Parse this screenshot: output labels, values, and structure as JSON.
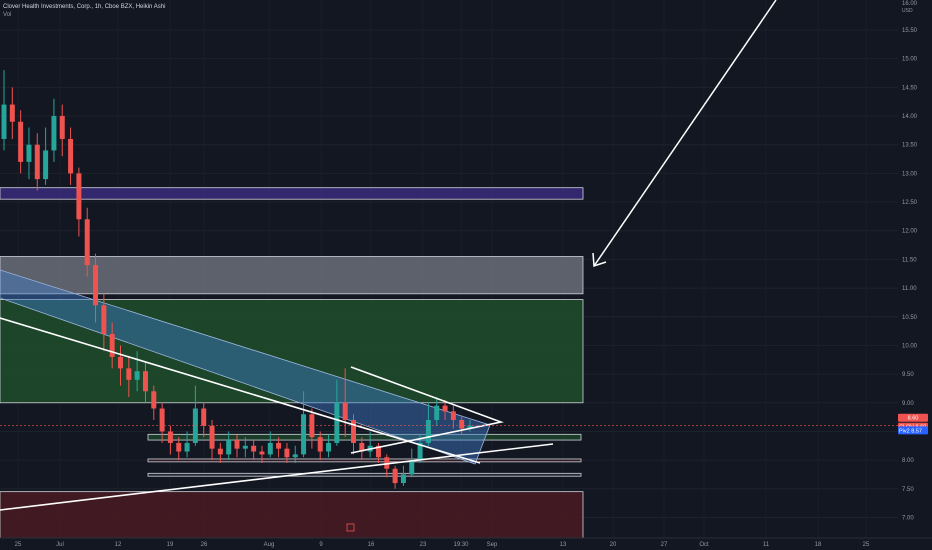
{
  "header": {
    "title": "Clover Health Investments, Corp., 1h, Cboe BZX, Heikin Ashi",
    "volume_label": "Vol"
  },
  "colors": {
    "background": "#131722",
    "up": "#26a69a",
    "down": "#ef5350",
    "purple_zone": "#3a2a7a",
    "grey_zone": "#6b6e78",
    "green_zone": "#1e4d2b",
    "red_zone": "#4a1a22",
    "blue_channel": "#3d7cc9"
  },
  "chart_data": {
    "type": "candlestick",
    "y_unit": "USD",
    "ylim": [
      6.75,
      16.0
    ],
    "y_ticks": [
      7.0,
      7.5,
      8.0,
      8.5,
      9.0,
      9.5,
      10.0,
      10.5,
      11.0,
      11.5,
      12.0,
      12.5,
      13.0,
      13.5,
      14.0,
      14.5,
      15.0,
      15.5
    ],
    "x_ticks": [
      "25",
      "Jul",
      "12",
      "19",
      "26",
      "Aug",
      "9",
      "16",
      "23",
      "19:30",
      "Sep",
      "13",
      "20",
      "27",
      "Oct",
      "11",
      "18",
      "25"
    ],
    "last_price_label": "CLOV",
    "last_price": "8.60",
    "last_price_top": "8.60",
    "pivot_label": "Piv2",
    "pivot_value": "8.57",
    "zones": [
      {
        "name": "purple",
        "low": 12.55,
        "high": 12.75
      },
      {
        "name": "grey",
        "low": 10.9,
        "high": 11.55
      },
      {
        "name": "green",
        "low": 9.0,
        "high": 10.8
      },
      {
        "name": "support-1",
        "low": 8.35,
        "high": 8.45
      },
      {
        "name": "support-2",
        "low": 7.97,
        "high": 8.02
      },
      {
        "name": "support-3",
        "low": 7.72,
        "high": 7.77
      },
      {
        "name": "red",
        "low": 6.5,
        "high": 7.45
      }
    ],
    "candles": [
      [
        13.6,
        14.2,
        14.8,
        13.4
      ],
      [
        14.2,
        13.9,
        14.5,
        13.6
      ],
      [
        13.9,
        13.2,
        14.1,
        13.0
      ],
      [
        13.2,
        13.5,
        13.8,
        12.9
      ],
      [
        13.5,
        12.9,
        13.7,
        12.7
      ],
      [
        12.9,
        13.4,
        13.8,
        12.8
      ],
      [
        13.4,
        14.0,
        14.3,
        13.2
      ],
      [
        14.0,
        13.6,
        14.2,
        13.3
      ],
      [
        13.6,
        13.0,
        13.8,
        12.8
      ],
      [
        13.0,
        12.2,
        13.1,
        11.9
      ],
      [
        12.2,
        11.4,
        12.4,
        11.2
      ],
      [
        11.4,
        10.7,
        11.6,
        10.4
      ],
      [
        10.7,
        10.2,
        10.9,
        9.9
      ],
      [
        10.2,
        9.8,
        10.4,
        9.6
      ],
      [
        9.8,
        9.6,
        10.0,
        9.3
      ],
      [
        9.6,
        9.4,
        9.8,
        9.1
      ],
      [
        9.4,
        9.55,
        9.9,
        9.2
      ],
      [
        9.55,
        9.2,
        9.7,
        9.0
      ],
      [
        9.2,
        8.9,
        9.3,
        8.7
      ],
      [
        8.9,
        8.5,
        9.0,
        8.3
      ],
      [
        8.5,
        8.3,
        8.6,
        8.1
      ],
      [
        8.3,
        8.15,
        8.4,
        8.0
      ],
      [
        8.15,
        8.3,
        8.5,
        8.05
      ],
      [
        8.3,
        8.9,
        9.3,
        8.25
      ],
      [
        8.9,
        8.6,
        9.0,
        8.4
      ],
      [
        8.6,
        8.2,
        8.7,
        8.0
      ],
      [
        8.2,
        8.1,
        8.3,
        7.95
      ],
      [
        8.1,
        8.35,
        8.5,
        8.0
      ],
      [
        8.35,
        8.2,
        8.45,
        8.05
      ],
      [
        8.2,
        8.25,
        8.4,
        8.05
      ],
      [
        8.25,
        8.15,
        8.35,
        8.0
      ],
      [
        8.15,
        8.1,
        8.25,
        7.95
      ],
      [
        8.1,
        8.3,
        8.5,
        8.05
      ],
      [
        8.3,
        8.2,
        8.4,
        8.05
      ],
      [
        8.2,
        8.05,
        8.3,
        7.95
      ],
      [
        8.05,
        8.1,
        8.25,
        7.95
      ],
      [
        8.1,
        8.8,
        9.2,
        8.05
      ],
      [
        8.8,
        8.4,
        8.9,
        8.2
      ],
      [
        8.4,
        8.15,
        8.5,
        8.0
      ],
      [
        8.15,
        8.3,
        8.45,
        8.05
      ],
      [
        8.3,
        9.0,
        9.4,
        8.25
      ],
      [
        9.0,
        8.7,
        9.6,
        8.4
      ],
      [
        8.7,
        8.3,
        8.8,
        8.1
      ],
      [
        8.3,
        8.15,
        8.4,
        8.0
      ],
      [
        8.15,
        8.25,
        8.5,
        8.05
      ],
      [
        8.25,
        8.05,
        8.3,
        7.95
      ],
      [
        8.05,
        7.85,
        8.1,
        7.7
      ],
      [
        7.85,
        7.6,
        7.9,
        7.5
      ],
      [
        7.6,
        7.75,
        7.9,
        7.55
      ],
      [
        7.75,
        8.0,
        8.2,
        7.7
      ],
      [
        8.0,
        8.3,
        8.45,
        7.95
      ],
      [
        8.3,
        8.7,
        9.0,
        8.25
      ],
      [
        8.7,
        8.95,
        9.1,
        8.6
      ],
      [
        8.95,
        8.85,
        9.05,
        8.7
      ],
      [
        8.85,
        8.7,
        8.95,
        8.55
      ],
      [
        8.7,
        8.55,
        8.75,
        8.45
      ],
      [
        8.55,
        8.6,
        8.7,
        8.5
      ]
    ]
  }
}
